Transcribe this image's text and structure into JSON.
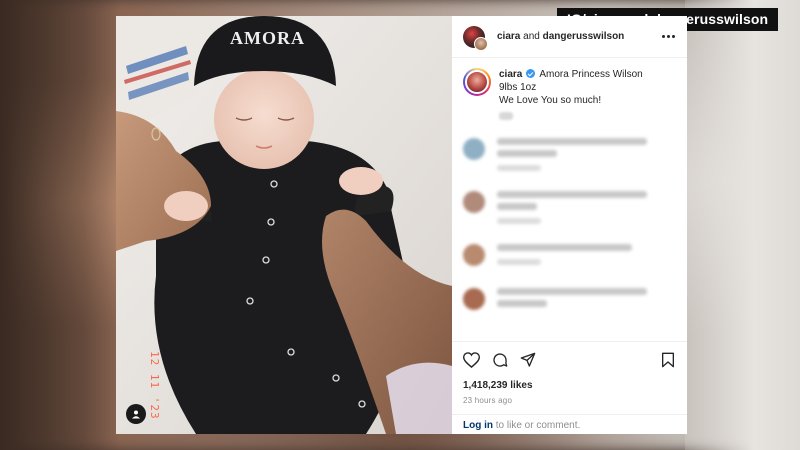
{
  "overlay": {
    "caption": "IG/ciara and dangerusswilson"
  },
  "photo": {
    "beanie_text": "AMORA",
    "date_stamp": "12 11 '23"
  },
  "post": {
    "header": {
      "user1": "ciara",
      "joiner": "and",
      "user2": "dangerusswilson"
    },
    "caption": {
      "username": "ciara",
      "line1": "Amora Princess Wilson",
      "line2": "9lbs 1oz",
      "line3": "We Love You so much!"
    },
    "likes": "1,418,239 likes",
    "time_ago": "23 hours ago",
    "login": {
      "link": "Log in",
      "rest": " to like or comment."
    }
  },
  "comment_avatar_colors": [
    "#8fb0c4",
    "#b08a7a",
    "#b88a70",
    "#a86a50"
  ],
  "icons": [
    "more-icon",
    "verified-badge-icon",
    "heart-icon",
    "comment-icon",
    "share-icon",
    "bookmark-icon",
    "user-tag-icon"
  ]
}
